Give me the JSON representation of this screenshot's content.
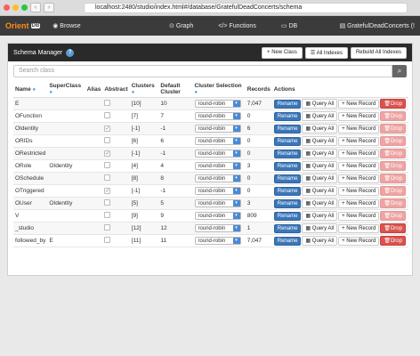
{
  "browser": {
    "url": "localhost:2480/studio/index.html#/database/GratefulDeadConcerts/schema"
  },
  "navbar": {
    "logo": "Orient",
    "logo_db": "DB",
    "browse": "Browse",
    "graph": "Graph",
    "functions": "Functions",
    "db": "DB",
    "database": "GratefulDeadConcerts (!"
  },
  "panel": {
    "title": "Schema Manager",
    "new_class": "+ New Class",
    "all_indexes": "All Indexes",
    "rebuild": "Rebuild All Indexes",
    "search_placeholder": "Search class"
  },
  "columns": {
    "name": "Name",
    "superclass": "SuperClass",
    "alias": "Alias",
    "abstract": "Abstract",
    "clusters": "Clusters",
    "default_cluster": "Default Cluster",
    "cluster_selection": "Cluster Selection",
    "records": "Records",
    "actions": "Actions"
  },
  "actions": {
    "rename": "Rename",
    "query_all": "Query All",
    "new_record": "+ New Record",
    "drop": "Drop"
  },
  "rows": [
    {
      "name": "E",
      "superclass": "",
      "abstract": false,
      "clusters": "[10]",
      "default_cluster": "10",
      "selection": "round-robin",
      "records": "7,047",
      "drop_disabled": false
    },
    {
      "name": "OFunction",
      "superclass": "",
      "abstract": false,
      "clusters": "[7]",
      "default_cluster": "7",
      "selection": "round-robin",
      "records": "0",
      "drop_disabled": true
    },
    {
      "name": "OIdentity",
      "superclass": "",
      "abstract": true,
      "clusters": "[-1]",
      "default_cluster": "-1",
      "selection": "round-robin",
      "records": "6",
      "drop_disabled": true
    },
    {
      "name": "ORIDs",
      "superclass": "",
      "abstract": false,
      "clusters": "[6]",
      "default_cluster": "6",
      "selection": "round-robin",
      "records": "0",
      "drop_disabled": true
    },
    {
      "name": "ORestricted",
      "superclass": "",
      "abstract": true,
      "clusters": "[-1]",
      "default_cluster": "-1",
      "selection": "round-robin",
      "records": "0",
      "drop_disabled": true
    },
    {
      "name": "ORole",
      "superclass": "OIdentity",
      "abstract": false,
      "clusters": "[4]",
      "default_cluster": "4",
      "selection": "round-robin",
      "records": "3",
      "drop_disabled": true
    },
    {
      "name": "OSchedule",
      "superclass": "",
      "abstract": false,
      "clusters": "[8]",
      "default_cluster": "8",
      "selection": "round-robin",
      "records": "0",
      "drop_disabled": true
    },
    {
      "name": "OTriggered",
      "superclass": "",
      "abstract": true,
      "clusters": "[-1]",
      "default_cluster": "-1",
      "selection": "round-robin",
      "records": "0",
      "drop_disabled": true
    },
    {
      "name": "OUser",
      "superclass": "OIdentity",
      "abstract": false,
      "clusters": "[5]",
      "default_cluster": "5",
      "selection": "round-robin",
      "records": "3",
      "drop_disabled": true
    },
    {
      "name": "V",
      "superclass": "",
      "abstract": false,
      "clusters": "[9]",
      "default_cluster": "9",
      "selection": "round-robin",
      "records": "809",
      "drop_disabled": true
    },
    {
      "name": "_studio",
      "superclass": "",
      "abstract": false,
      "clusters": "[12]",
      "default_cluster": "12",
      "selection": "round-robin",
      "records": "1",
      "drop_disabled": false
    },
    {
      "name": "followed_by",
      "superclass": "E",
      "abstract": false,
      "clusters": "[11]",
      "default_cluster": "11",
      "selection": "round-robin",
      "records": "7,047",
      "drop_disabled": false
    }
  ]
}
